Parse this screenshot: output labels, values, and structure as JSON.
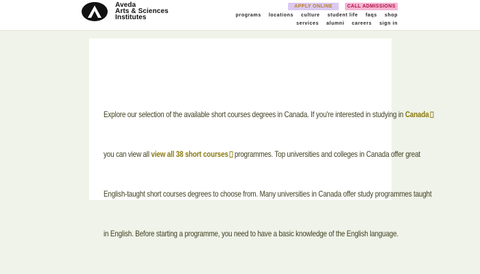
{
  "brand": {
    "line1": "Aveda",
    "line2": "Arts & Sciences",
    "line3": "Institutes"
  },
  "cta": {
    "apply": "APPLY ONLINE",
    "call": "CALL ADMISSIONS"
  },
  "nav": {
    "row1": [
      "programs",
      "locations",
      "culture",
      "student life",
      "faqs",
      "shop"
    ],
    "row2": [
      "services",
      "alumni",
      "careers",
      "sign in"
    ]
  },
  "body": {
    "l1_before": "Explore our selection of the available short courses degrees in Canada. If you're interested in studying in",
    "l1_link": "Canada",
    "l2_before": "you can view all",
    "l2_link": "view all 38 short courses",
    "l2_after": "programmes. Top universities and colleges in Canada offer great",
    "l3": "English-taught short courses degrees to choose from. Many universities in Canada offer study programmes taught",
    "l4": "in English. Before starting a programme, you need to have a basic knowledge of the English language."
  },
  "colors": {
    "background": "#eff3e9",
    "link": "#8a7a10",
    "apply_bg": "#dcc9f2",
    "call_bg": "#f4b5d5",
    "call_text": "#b1123c"
  }
}
